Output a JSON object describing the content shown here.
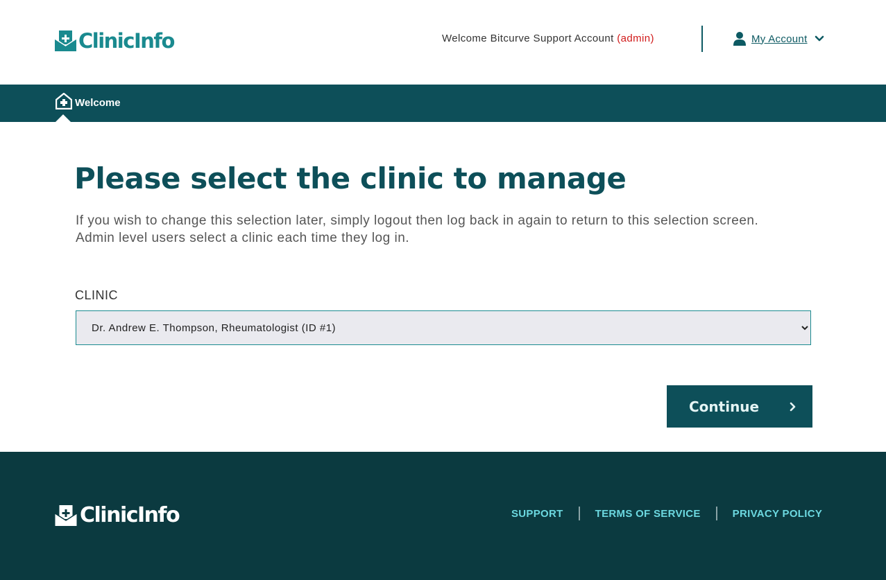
{
  "header": {
    "logo_text": "ClinicInfo",
    "welcome_prefix": "Welcome Bitcurve Support Account ",
    "welcome_role": "(admin)",
    "account_label": "My Account"
  },
  "nav": {
    "home_label": "Welcome"
  },
  "main": {
    "title": "Please select the clinic to manage",
    "intro_line1": "If you wish to change this selection later, simply logout then log back in again to return to this selection screen.",
    "intro_line2": "Admin level users select a clinic each time they log in.",
    "clinic_label": "CLINIC",
    "clinic_selected": "Dr. Andrew E. Thompson, Rheumatologist (ID #1)",
    "continue_label": "Continue"
  },
  "footer": {
    "logo_text": "ClinicInfo",
    "links": [
      "SUPPORT",
      "TERMS OF SERVICE",
      "PRIVACY POLICY"
    ]
  },
  "colors": {
    "brand_teal": "#1a8a8f",
    "nav_dark": "#0d4f59",
    "footer_bg": "#0b3a40",
    "admin_red": "#d11a1a",
    "footer_link": "#6cd8e0"
  }
}
